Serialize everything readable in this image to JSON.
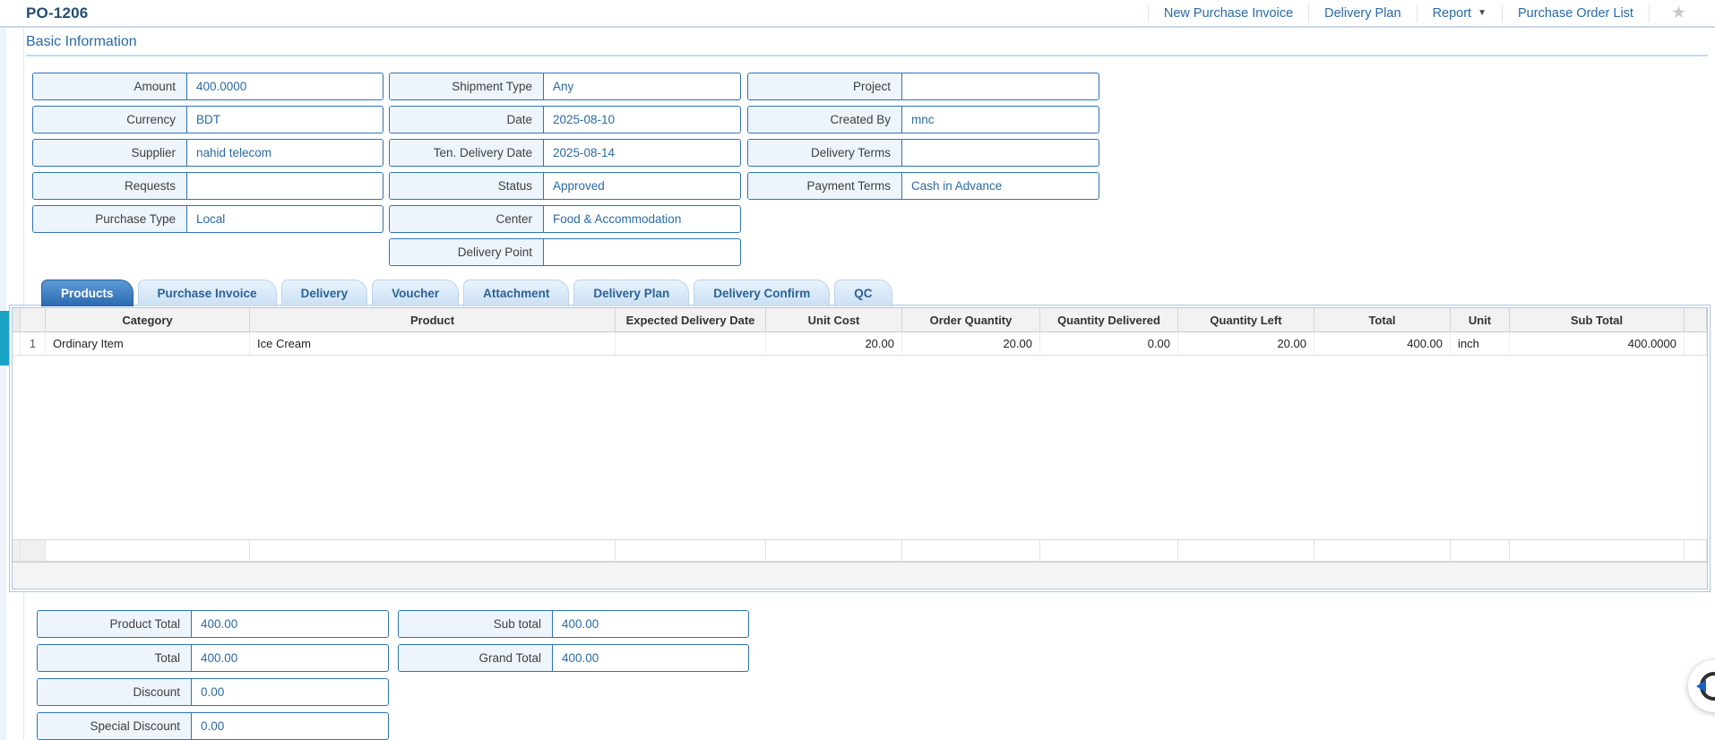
{
  "header": {
    "title": "PO-1206",
    "links": [
      {
        "label": "New Purchase Invoice"
      },
      {
        "label": "Delivery Plan"
      },
      {
        "label": "Report",
        "caret": "▼"
      },
      {
        "label": "Purchase Order List"
      }
    ],
    "star_icon": "★"
  },
  "section_title": "Basic Information",
  "form": {
    "col1": [
      {
        "label": "Amount",
        "value": "400.0000"
      },
      {
        "label": "Currency",
        "value": "BDT"
      },
      {
        "label": "Supplier",
        "value": "nahid telecom"
      },
      {
        "label": "Requests",
        "value": ""
      },
      {
        "label": "Purchase Type",
        "value": "Local"
      }
    ],
    "col2": [
      {
        "label": "Shipment Type",
        "value": "Any"
      },
      {
        "label": "Date",
        "value": "2025-08-10"
      },
      {
        "label": "Ten. Delivery Date",
        "value": "2025-08-14"
      },
      {
        "label": "Status",
        "value": "Approved"
      },
      {
        "label": "Center",
        "value": "Food & Accommodation"
      },
      {
        "label": "Delivery Point",
        "value": ""
      }
    ],
    "col3": [
      {
        "label": "Project",
        "value": ""
      },
      {
        "label": "Created By",
        "value": "mnc"
      },
      {
        "label": "Delivery Terms",
        "value": ""
      },
      {
        "label": "Payment Terms",
        "value": "Cash in Advance"
      }
    ]
  },
  "tabs": {
    "active": "Products",
    "items": [
      "Products",
      "Purchase Invoice",
      "Delivery",
      "Voucher",
      "Attachment",
      "Delivery Plan",
      "Delivery Confirm",
      "QC"
    ]
  },
  "products_table": {
    "columns": [
      "Category",
      "Product",
      "Expected Delivery Date",
      "Unit Cost",
      "Order Quantity",
      "Quantity Delivered",
      "Quantity Left",
      "Total",
      "Unit",
      "Sub Total"
    ],
    "rows": [
      {
        "no": "1",
        "category": "Ordinary Item",
        "product": "Ice Cream",
        "expected_delivery_date": "",
        "unit_cost": "20.00",
        "order_quantity": "20.00",
        "quantity_delivered": "0.00",
        "quantity_left": "20.00",
        "total": "400.00",
        "unit": "inch",
        "sub_total": "400.0000"
      }
    ]
  },
  "totals": {
    "left": [
      {
        "label": "Product Total",
        "value": "400.00"
      },
      {
        "label": "Total",
        "value": "400.00"
      },
      {
        "label": "Discount",
        "value": "0.00"
      },
      {
        "label": "Special Discount",
        "value": "0.00"
      }
    ],
    "right": [
      {
        "label": "Sub total",
        "value": "400.00"
      },
      {
        "label": "Grand Total",
        "value": "400.00"
      }
    ]
  },
  "colors": {
    "accent_blue": "#2a6aa5",
    "title_blue": "#1f4e79",
    "field_border": "#2e74b5",
    "field_label_bg": "#edf4fb",
    "active_tab": "#2d6bb0",
    "inactive_tab_bg": "#cadff3",
    "panel_border": "#a9c8e8",
    "teal_selection_bar": "#1aa3c4",
    "table_header_bg": "#f2f2f2",
    "star_gray": "#c6cace",
    "fab_arrow_blue": "#1760c4"
  }
}
